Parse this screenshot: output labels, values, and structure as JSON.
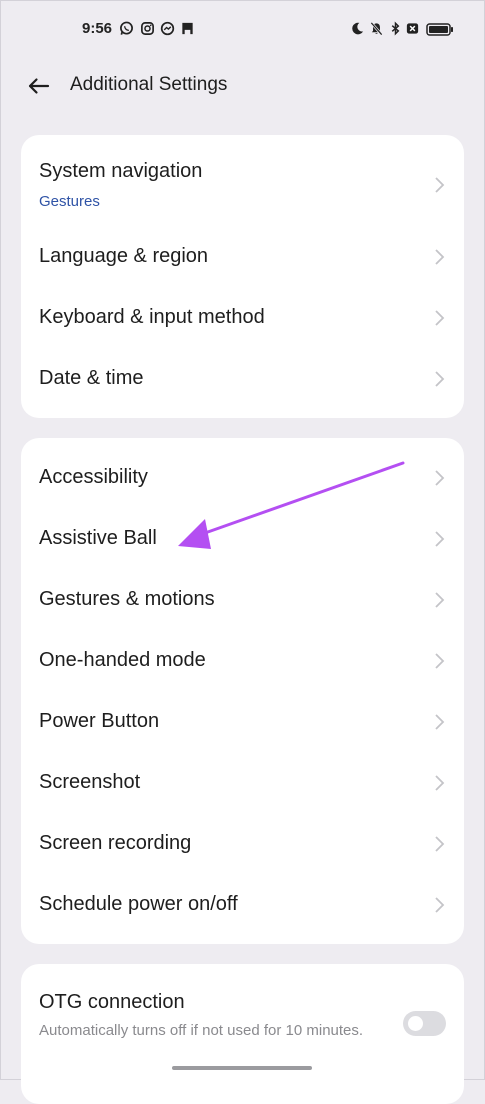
{
  "status_bar": {
    "time": "9:56",
    "left_icons": [
      "whatsapp-icon",
      "instagram-icon",
      "messenger-icon",
      "app-icon"
    ],
    "right_icons": [
      "moon-icon",
      "bell-off-icon",
      "bluetooth-icon",
      "no-sim-icon",
      "battery-icon"
    ]
  },
  "header": {
    "title": "Additional Settings",
    "back_icon": "arrow-left-icon"
  },
  "card1": {
    "items": [
      {
        "label": "System navigation",
        "value": "Gestures"
      },
      {
        "label": "Language & region"
      },
      {
        "label": "Keyboard & input method"
      },
      {
        "label": "Date & time"
      }
    ]
  },
  "card2": {
    "items": [
      {
        "label": "Accessibility"
      },
      {
        "label": "Assistive Ball"
      },
      {
        "label": "Gestures & motions"
      },
      {
        "label": "One-handed mode"
      },
      {
        "label": "Power Button"
      },
      {
        "label": "Screenshot"
      },
      {
        "label": "Screen recording"
      },
      {
        "label": "Schedule power on/off"
      }
    ]
  },
  "card3": {
    "otg": {
      "label": "OTG connection",
      "description": "Automatically turns off if not used for 10 minutes.",
      "enabled": false
    }
  },
  "colors": {
    "background": "#eeecf1",
    "card": "#ffffff",
    "accent_text": "#2f53a6",
    "annotation_arrow": "#b44ff2"
  }
}
